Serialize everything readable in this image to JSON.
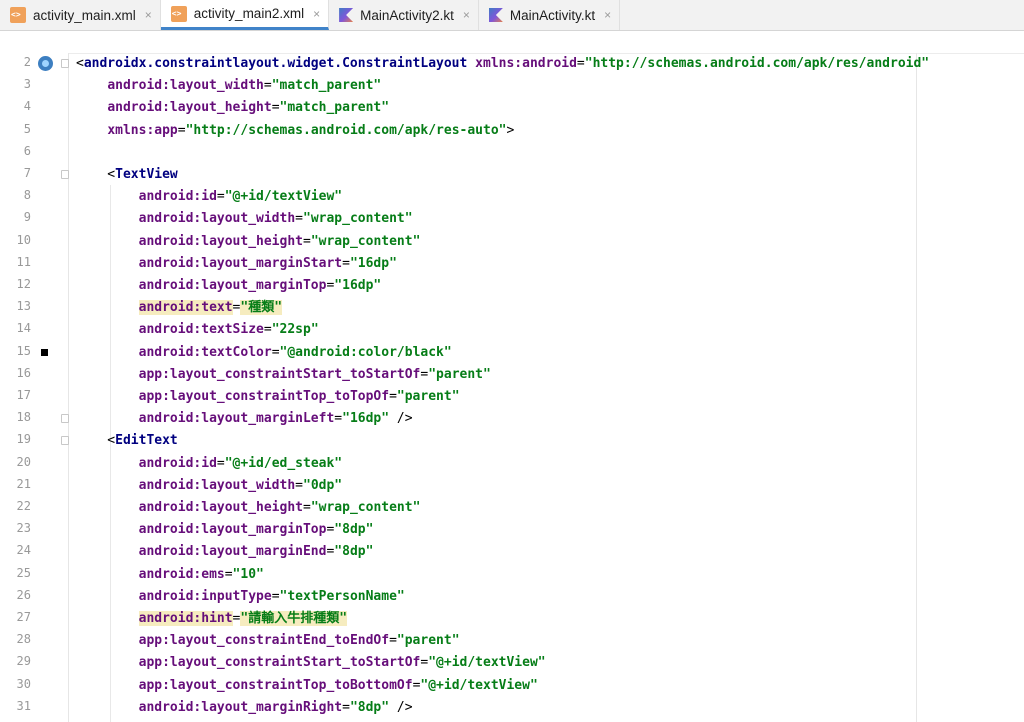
{
  "tabs": [
    {
      "label": "activity_main.xml",
      "type": "xml",
      "active": false
    },
    {
      "label": "activity_main2.xml",
      "type": "xml",
      "active": true
    },
    {
      "label": "MainActivity2.kt",
      "type": "kt",
      "active": false
    },
    {
      "label": "MainActivity.kt",
      "type": "kt",
      "active": false
    }
  ],
  "close_glyph": "×",
  "colors": {
    "tag": "#000080",
    "attribute": "#660e7a",
    "value": "#067d17",
    "highlight": "#f6ecbf",
    "active_tab_accent": "#4083c9"
  },
  "lines": [
    {
      "n": "2",
      "icon": "layout-preview-icon",
      "fold": true,
      "segs": [
        [
          "punct",
          "<"
        ],
        [
          "tag",
          "androidx.constraintlayout.widget.ConstraintLayout"
        ],
        [
          "punct",
          " "
        ],
        [
          "attr",
          "xmlns:android"
        ],
        [
          "punct",
          "="
        ],
        [
          "val",
          "\"http://schemas.android.com/apk/res/android\""
        ]
      ]
    },
    {
      "n": "3",
      "segs": [
        [
          "punct",
          "    "
        ],
        [
          "attr",
          "android:layout_width"
        ],
        [
          "punct",
          "="
        ],
        [
          "val",
          "\"match_parent\""
        ]
      ]
    },
    {
      "n": "4",
      "segs": [
        [
          "punct",
          "    "
        ],
        [
          "attr",
          "android:layout_height"
        ],
        [
          "punct",
          "="
        ],
        [
          "val",
          "\"match_parent\""
        ]
      ]
    },
    {
      "n": "5",
      "segs": [
        [
          "punct",
          "    "
        ],
        [
          "attr",
          "xmlns:app"
        ],
        [
          "punct",
          "="
        ],
        [
          "val",
          "\"http://schemas.android.com/apk/res-auto\""
        ],
        [
          "punct",
          ">"
        ]
      ]
    },
    {
      "n": "6",
      "segs": []
    },
    {
      "n": "7",
      "fold": true,
      "segs": [
        [
          "punct",
          "    <"
        ],
        [
          "tag",
          "TextView"
        ]
      ]
    },
    {
      "n": "8",
      "segs": [
        [
          "punct",
          "        "
        ],
        [
          "attr",
          "android:id"
        ],
        [
          "punct",
          "="
        ],
        [
          "val",
          "\"@+id/textView\""
        ]
      ]
    },
    {
      "n": "9",
      "segs": [
        [
          "punct",
          "        "
        ],
        [
          "attr",
          "android:layout_width"
        ],
        [
          "punct",
          "="
        ],
        [
          "val",
          "\"wrap_content\""
        ]
      ]
    },
    {
      "n": "10",
      "segs": [
        [
          "punct",
          "        "
        ],
        [
          "attr",
          "android:layout_height"
        ],
        [
          "punct",
          "="
        ],
        [
          "val",
          "\"wrap_content\""
        ]
      ]
    },
    {
      "n": "11",
      "segs": [
        [
          "punct",
          "        "
        ],
        [
          "attr",
          "android:layout_marginStart"
        ],
        [
          "punct",
          "="
        ],
        [
          "val",
          "\"16dp\""
        ]
      ]
    },
    {
      "n": "12",
      "segs": [
        [
          "punct",
          "        "
        ],
        [
          "attr",
          "android:layout_marginTop"
        ],
        [
          "punct",
          "="
        ],
        [
          "val",
          "\"16dp\""
        ]
      ]
    },
    {
      "n": "13",
      "hl": true,
      "segs": [
        [
          "punct",
          "        "
        ],
        [
          "attr",
          "android:text"
        ],
        [
          "punct",
          "="
        ],
        [
          "val",
          "\"種類\""
        ]
      ]
    },
    {
      "n": "14",
      "segs": [
        [
          "punct",
          "        "
        ],
        [
          "attr",
          "android:textSize"
        ],
        [
          "punct",
          "="
        ],
        [
          "val",
          "\"22sp\""
        ]
      ]
    },
    {
      "n": "15",
      "bp": true,
      "segs": [
        [
          "punct",
          "        "
        ],
        [
          "attr",
          "android:textColor"
        ],
        [
          "punct",
          "="
        ],
        [
          "val",
          "\"@android:color/black\""
        ]
      ]
    },
    {
      "n": "16",
      "segs": [
        [
          "punct",
          "        "
        ],
        [
          "attr",
          "app:layout_constraintStart_toStartOf"
        ],
        [
          "punct",
          "="
        ],
        [
          "val",
          "\"parent\""
        ]
      ]
    },
    {
      "n": "17",
      "segs": [
        [
          "punct",
          "        "
        ],
        [
          "attr",
          "app:layout_constraintTop_toTopOf"
        ],
        [
          "punct",
          "="
        ],
        [
          "val",
          "\"parent\""
        ]
      ]
    },
    {
      "n": "18",
      "fold": true,
      "segs": [
        [
          "punct",
          "        "
        ],
        [
          "attr",
          "android:layout_marginLeft"
        ],
        [
          "punct",
          "="
        ],
        [
          "val",
          "\"16dp\""
        ],
        [
          "punct",
          " />"
        ]
      ]
    },
    {
      "n": "19",
      "fold": true,
      "segs": [
        [
          "punct",
          "    <"
        ],
        [
          "tag",
          "EditText"
        ]
      ]
    },
    {
      "n": "20",
      "segs": [
        [
          "punct",
          "        "
        ],
        [
          "attr",
          "android:id"
        ],
        [
          "punct",
          "="
        ],
        [
          "val",
          "\"@+id/ed_steak\""
        ]
      ]
    },
    {
      "n": "21",
      "segs": [
        [
          "punct",
          "        "
        ],
        [
          "attr",
          "android:layout_width"
        ],
        [
          "punct",
          "="
        ],
        [
          "val",
          "\"0dp\""
        ]
      ]
    },
    {
      "n": "22",
      "segs": [
        [
          "punct",
          "        "
        ],
        [
          "attr",
          "android:layout_height"
        ],
        [
          "punct",
          "="
        ],
        [
          "val",
          "\"wrap_content\""
        ]
      ]
    },
    {
      "n": "23",
      "segs": [
        [
          "punct",
          "        "
        ],
        [
          "attr",
          "android:layout_marginTop"
        ],
        [
          "punct",
          "="
        ],
        [
          "val",
          "\"8dp\""
        ]
      ]
    },
    {
      "n": "24",
      "segs": [
        [
          "punct",
          "        "
        ],
        [
          "attr",
          "android:layout_marginEnd"
        ],
        [
          "punct",
          "="
        ],
        [
          "val",
          "\"8dp\""
        ]
      ]
    },
    {
      "n": "25",
      "segs": [
        [
          "punct",
          "        "
        ],
        [
          "attr",
          "android:ems"
        ],
        [
          "punct",
          "="
        ],
        [
          "val",
          "\"10\""
        ]
      ]
    },
    {
      "n": "26",
      "segs": [
        [
          "punct",
          "        "
        ],
        [
          "attr",
          "android:inputType"
        ],
        [
          "punct",
          "="
        ],
        [
          "val",
          "\"textPersonName\""
        ]
      ]
    },
    {
      "n": "27",
      "hl": true,
      "segs": [
        [
          "punct",
          "        "
        ],
        [
          "attr",
          "android:hint"
        ],
        [
          "punct",
          "="
        ],
        [
          "val",
          "\"請輸入牛排種類\""
        ]
      ]
    },
    {
      "n": "28",
      "segs": [
        [
          "punct",
          "        "
        ],
        [
          "attr",
          "app:layout_constraintEnd_toEndOf"
        ],
        [
          "punct",
          "="
        ],
        [
          "val",
          "\"parent\""
        ]
      ]
    },
    {
      "n": "29",
      "segs": [
        [
          "punct",
          "        "
        ],
        [
          "attr",
          "app:layout_constraintStart_toStartOf"
        ],
        [
          "punct",
          "="
        ],
        [
          "val",
          "\"@+id/textView\""
        ]
      ]
    },
    {
      "n": "30",
      "segs": [
        [
          "punct",
          "        "
        ],
        [
          "attr",
          "app:layout_constraintTop_toBottomOf"
        ],
        [
          "punct",
          "="
        ],
        [
          "val",
          "\"@+id/textView\""
        ]
      ]
    },
    {
      "n": "31",
      "segs": [
        [
          "punct",
          "        "
        ],
        [
          "attr",
          "android:layout_marginRight"
        ],
        [
          "punct",
          "="
        ],
        [
          "val",
          "\"8dp\""
        ],
        [
          "punct",
          " />"
        ]
      ]
    }
  ]
}
